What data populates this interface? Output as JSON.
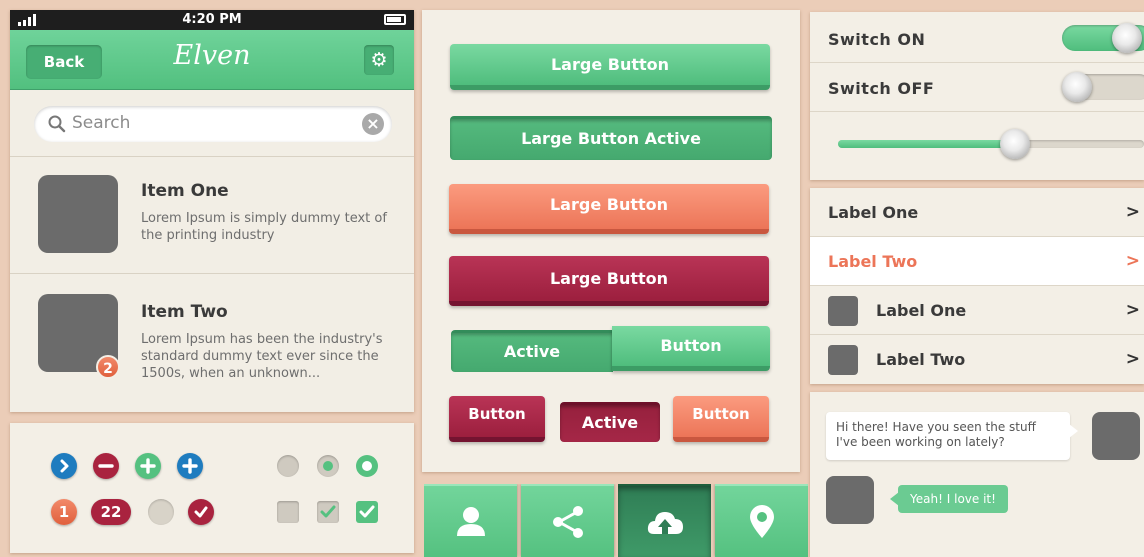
{
  "colors": {
    "green": "#55c180",
    "salmon": "#ec7558",
    "maroon": "#9c1f3e",
    "blue": "#1e7cbf",
    "grey": "#6b6b6b",
    "bg": "#ebcdb8",
    "panel": "#f3efe6"
  },
  "phone": {
    "status": {
      "time": "4:20 PM"
    },
    "navbar": {
      "back_label": "Back",
      "logo": "Elven",
      "settings_icon": "gear-icon"
    },
    "search": {
      "placeholder": "Search"
    },
    "items": [
      {
        "title": "Item One",
        "desc": "Lorem Ipsum is simply dummy text of the printing industry"
      },
      {
        "title": "Item Two",
        "desc": "Lorem Ipsum has been the industry's standard dummy text ever since the 1500s, when an unknown...",
        "badge": "2"
      }
    ]
  },
  "controls": {
    "badge_one": "1",
    "badge_pill": "22"
  },
  "buttons": {
    "large1": "Large Button",
    "large_active": "Large Button Active",
    "large_salmon": "Large Button",
    "large_maroon": "Large Button",
    "seg_active": "Active",
    "seg_button": "Button",
    "small_button": "Button",
    "small_active": "Active",
    "small_salmon": "Button"
  },
  "tabbar": {
    "tabs": [
      "user-icon",
      "share-icon",
      "cloud-upload-icon",
      "location-pin-icon"
    ],
    "active_index": 2
  },
  "switches": {
    "on_label": "Switch ON",
    "off_label": "Switch OFF",
    "on": true,
    "off": false,
    "slider_level": 0.58
  },
  "list": [
    {
      "label": "Label One",
      "selected": false,
      "thumb": false
    },
    {
      "label": "Label Two",
      "selected": true,
      "thumb": false
    },
    {
      "label": "Label One",
      "selected": false,
      "thumb": true
    },
    {
      "label": "Label Two",
      "selected": false,
      "thumb": true
    }
  ],
  "chat": {
    "incoming": "Hi there! Have you seen the stuff I've been working on lately?",
    "outgoing": "Yeah! I love it!"
  }
}
